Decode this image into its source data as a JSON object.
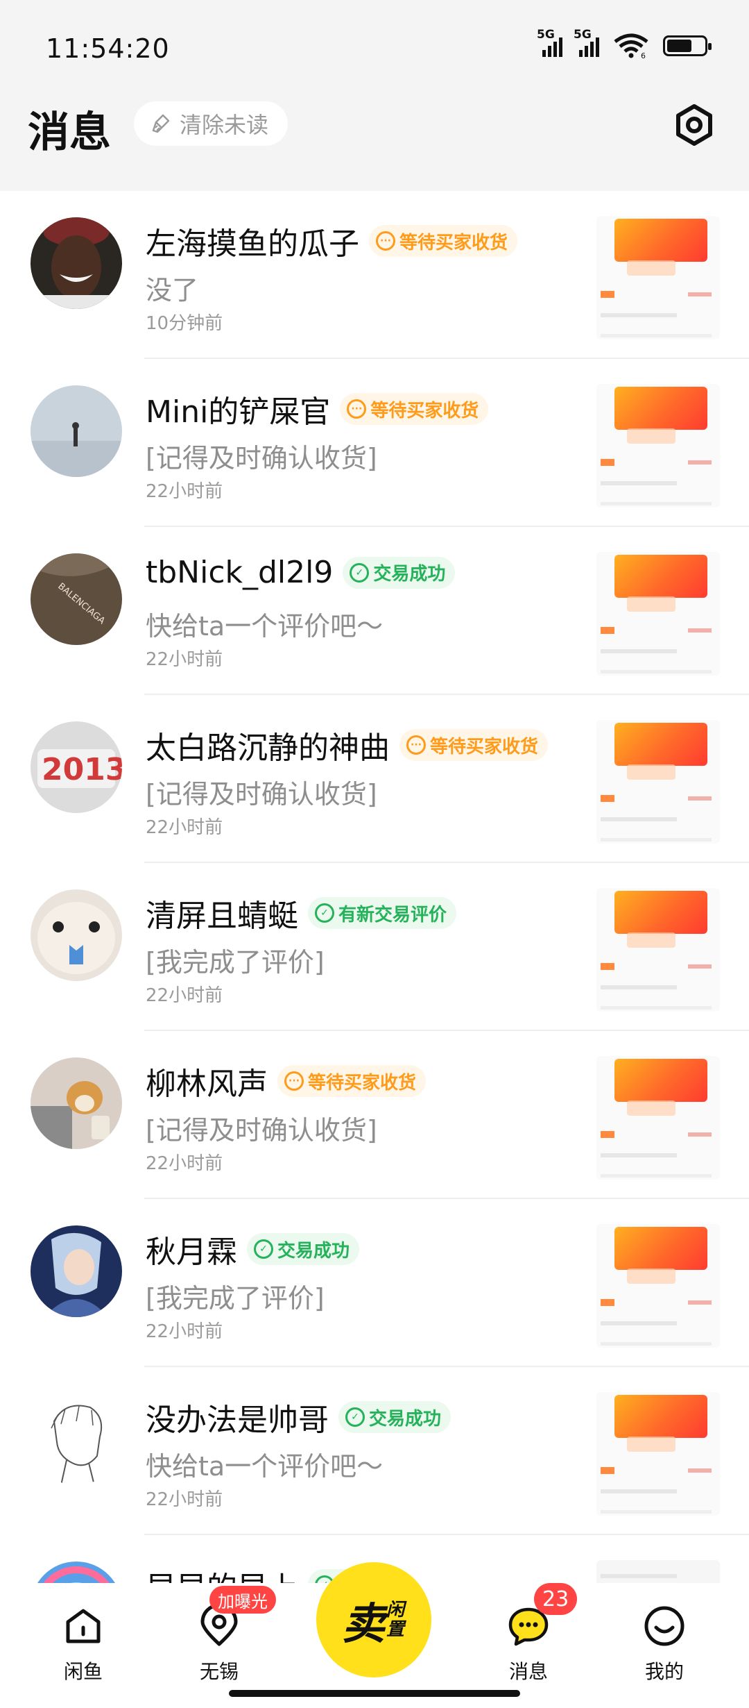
{
  "status": {
    "time": "11:54:20",
    "network1": "5G",
    "network2": "5G",
    "wifi_badge": "6"
  },
  "header": {
    "title": "消息",
    "clear_label": "清除未读"
  },
  "conversations": [
    {
      "name": "左海摸鱼的瓜子",
      "badge": "等待买家收货",
      "badge_type": "waiting",
      "message": "没了",
      "time": "10分钟前"
    },
    {
      "name": "Mini的铲屎官",
      "badge": "等待买家收货",
      "badge_type": "waiting",
      "message": "[记得及时确认收货]",
      "time": "22小时前"
    },
    {
      "name": "tbNick_dl2l9",
      "badge": "交易成功",
      "badge_type": "success",
      "message": "快给ta一个评价吧～",
      "time": "22小时前"
    },
    {
      "name": "太白路沉静的神曲",
      "badge": "等待买家收货",
      "badge_type": "waiting",
      "message": "[记得及时确认收货]",
      "time": "22小时前"
    },
    {
      "name": "清屏且蜻蜓",
      "badge": "有新交易评价",
      "badge_type": "success",
      "message": "[我完成了评价]",
      "time": "22小时前"
    },
    {
      "name": "柳林风声",
      "badge": "等待买家收货",
      "badge_type": "waiting",
      "message": "[记得及时确认收货]",
      "time": "22小时前"
    },
    {
      "name": "秋月霖",
      "badge": "交易成功",
      "badge_type": "success",
      "message": "[我完成了评价]",
      "time": "22小时前"
    },
    {
      "name": "没办法是帅哥",
      "badge": "交易成功",
      "badge_type": "success",
      "message": "快给ta一个评价吧～",
      "time": "22小时前"
    },
    {
      "name": "早早的早上",
      "badge": "评价",
      "badge_type": "success",
      "message": "",
      "time": ""
    }
  ],
  "avatar_text": {
    "year": "2013",
    "brand": "BALENCIAGA"
  },
  "tabbar": {
    "home": "闲鱼",
    "local": "无锡",
    "local_badge": "加曝光",
    "sell_big": "卖",
    "sell_small": "闲置",
    "messages": "消息",
    "messages_count": "23",
    "me": "我的"
  },
  "colors": {
    "accent_yellow": "#ffe01a",
    "waiting": "#ff9b1a",
    "success": "#25b25a",
    "badge_red": "#ff4444"
  }
}
